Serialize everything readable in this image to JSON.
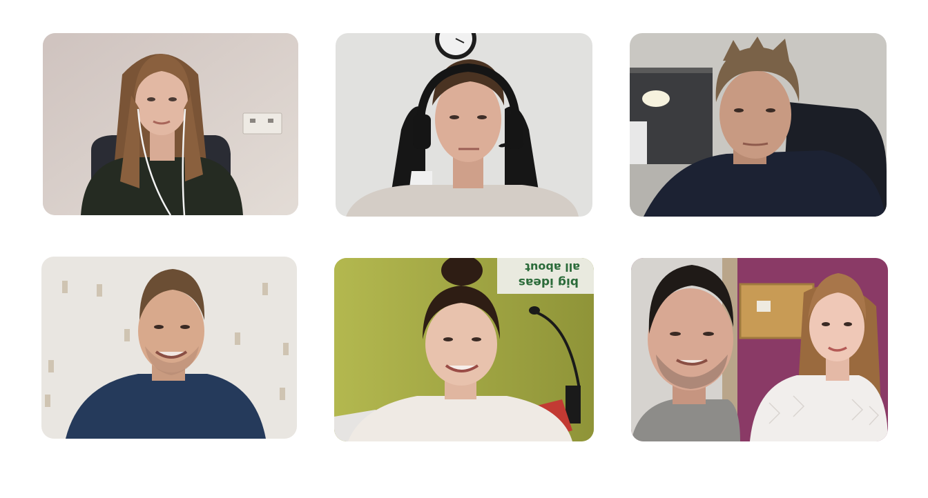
{
  "meeting": {
    "layout": "gallery",
    "participant_tiles": [
      {
        "id": "p1",
        "description": "woman with long hair, earphones, dark top"
      },
      {
        "id": "p2",
        "description": "man with headset in gaming chair"
      },
      {
        "id": "p3",
        "description": "man in dark hoodie, dim room"
      },
      {
        "id": "p4",
        "description": "smiling man in navy t-shirt"
      },
      {
        "id": "p5",
        "description": "woman with hair bun, white collar, green wall"
      },
      {
        "id": "p6",
        "description": "man and woman sharing a camera, purple wall"
      }
    ]
  },
  "background_text": {
    "poster_line1": "all about",
    "poster_line2": "big ideas"
  },
  "colors": {
    "page_background": "#ffffff",
    "wall_beige": "#d8d2cc",
    "wall_green": "#a9ad4a",
    "wall_purple": "#8a3a66",
    "skin": "#d9a88e",
    "dark_clothing": "#1f2230"
  }
}
